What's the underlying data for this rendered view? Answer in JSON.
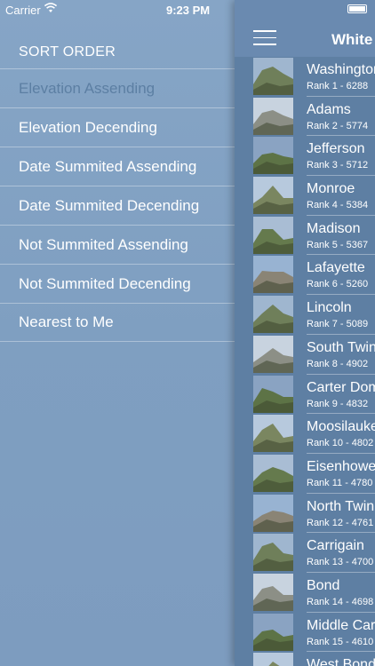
{
  "status": {
    "carrier": "Carrier",
    "time": "9:23 PM"
  },
  "menu": {
    "title": "SORT ORDER",
    "items": [
      {
        "label": "Elevation Assending",
        "selected": true
      },
      {
        "label": "Elevation Decending"
      },
      {
        "label": "Date Summited Assending"
      },
      {
        "label": "Date Summited Decending"
      },
      {
        "label": "Not Summited Assending"
      },
      {
        "label": "Not Summited Decending"
      },
      {
        "label": "Nearest to Me"
      }
    ]
  },
  "panel": {
    "title": "White",
    "peaks": [
      {
        "name": "Washington",
        "rank": "Rank 1 - 6288"
      },
      {
        "name": "Adams",
        "rank": "Rank 2 - 5774"
      },
      {
        "name": "Jefferson",
        "rank": "Rank 3 - 5712"
      },
      {
        "name": "Monroe",
        "rank": "Rank 4 - 5384"
      },
      {
        "name": "Madison",
        "rank": "Rank 5 - 5367"
      },
      {
        "name": "Lafayette",
        "rank": "Rank 6 - 5260"
      },
      {
        "name": "Lincoln",
        "rank": "Rank 7 - 5089"
      },
      {
        "name": "South Twin",
        "rank": "Rank 8 - 4902"
      },
      {
        "name": "Carter Dome",
        "rank": "Rank 9 - 4832"
      },
      {
        "name": "Moosilauke",
        "rank": "Rank 10 - 4802"
      },
      {
        "name": "Eisenhower",
        "rank": "Rank 11 - 4780"
      },
      {
        "name": "North Twin",
        "rank": "Rank 12 - 4761"
      },
      {
        "name": "Carrigain",
        "rank": "Rank 13 - 4700"
      },
      {
        "name": "Bond",
        "rank": "Rank 14 - 4698"
      },
      {
        "name": "Middle Carter",
        "rank": "Rank 15 - 4610"
      },
      {
        "name": "West Bond",
        "rank": ""
      }
    ]
  }
}
